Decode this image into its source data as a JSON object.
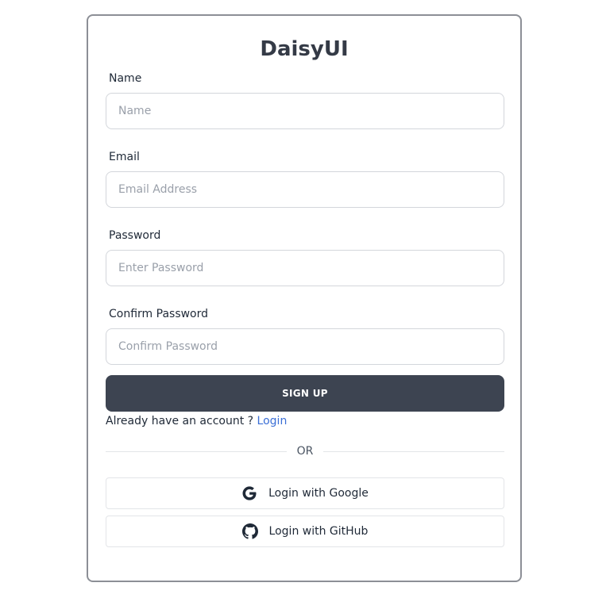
{
  "form": {
    "title": "DaisyUI",
    "fields": [
      {
        "label": "Name",
        "placeholder": "Name"
      },
      {
        "label": "Email",
        "placeholder": "Email Address"
      },
      {
        "label": "Password",
        "placeholder": "Enter Password"
      },
      {
        "label": "Confirm Password",
        "placeholder": "Confirm Password"
      }
    ],
    "submit_label": "SIGN UP",
    "already_text": "Already have an account ?",
    "login_link": "Login",
    "divider_text": "OR",
    "google_label": "Login with Google",
    "github_label": "Login with GitHub"
  },
  "colors": {
    "button_bg": "#3d4451",
    "link": "#3b6fd6",
    "card_border": "#8c8f96"
  },
  "icons": {
    "google": "google-icon",
    "github": "github-icon"
  }
}
